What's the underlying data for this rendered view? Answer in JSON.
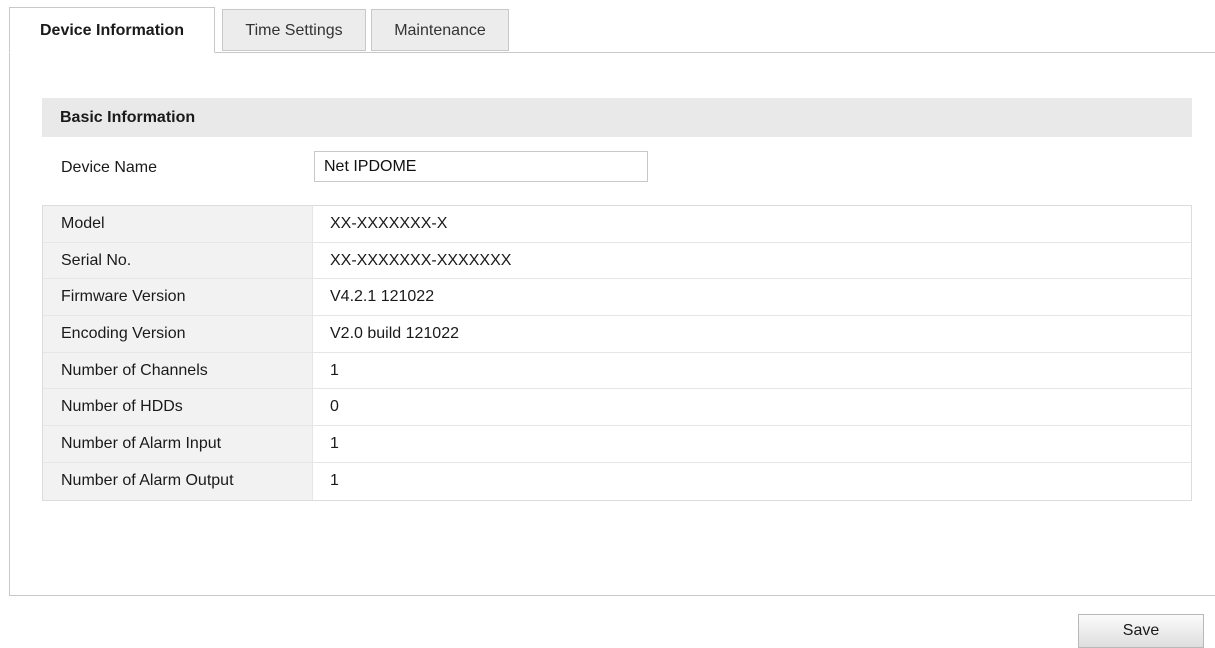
{
  "tabs": [
    {
      "label": "Device Information",
      "active": true
    },
    {
      "label": "Time Settings",
      "active": false
    },
    {
      "label": "Maintenance",
      "active": false
    }
  ],
  "basic_info": {
    "section_title": "Basic Information",
    "device_name_label": "Device Name",
    "device_name_value": "Net IPDOME"
  },
  "info_rows": [
    {
      "label": "Model",
      "value": "XX-XXXXXXX-X"
    },
    {
      "label": "Serial No.",
      "value": "XX-XXXXXXX-XXXXXXX"
    },
    {
      "label": "Firmware Version",
      "value": "V4.2.1 121022"
    },
    {
      "label": "Encoding Version",
      "value": "V2.0 build 121022"
    },
    {
      "label": "Number of Channels",
      "value": "1"
    },
    {
      "label": "Number of HDDs",
      "value": "0"
    },
    {
      "label": "Number of Alarm Input",
      "value": "1"
    },
    {
      "label": "Number of Alarm Output",
      "value": "1"
    }
  ],
  "actions": {
    "save_label": "Save"
  }
}
